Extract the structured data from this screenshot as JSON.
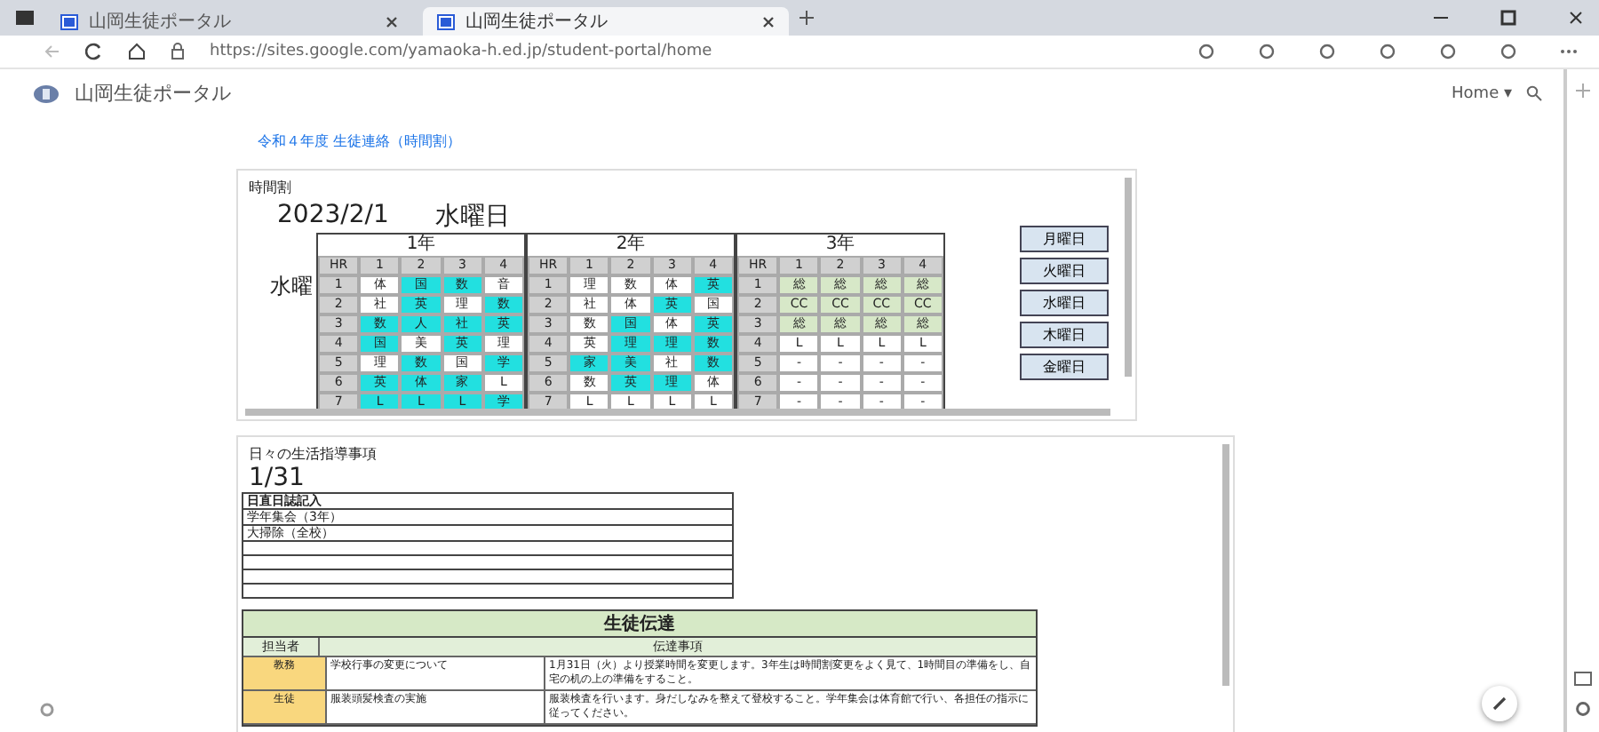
{
  "browser": {
    "tabs": [
      {
        "title": "山岡生徒ポータル",
        "selected": false
      },
      {
        "title": "山岡生徒ポータル",
        "selected": true
      }
    ],
    "url": "https://sites.google.com/yamaoka-h.ed.jp/student-portal/home"
  },
  "site": {
    "title": "山岡生徒ポータル",
    "nav": "Home ▾"
  },
  "link": "令和４年度 生徒連絡（時間割）",
  "timetable": {
    "label": "時間割",
    "date": "2023/2/1",
    "weekday": "水曜日",
    "day_label": "水曜",
    "years": [
      {
        "title": "1年",
        "header": [
          "HR",
          "1",
          "2",
          "3",
          "4"
        ],
        "rows": [
          [
            {
              "text": "1"
            },
            {
              "text": "体"
            },
            {
              "text": "国",
              "color": "#22e0e0"
            },
            {
              "text": "数",
              "color": "#22e0e0"
            },
            {
              "text": "音"
            }
          ],
          [
            {
              "text": "2"
            },
            {
              "text": "社"
            },
            {
              "text": "英",
              "color": "#22e0e0"
            },
            {
              "text": "理"
            },
            {
              "text": "数",
              "color": "#22e0e0"
            }
          ],
          [
            {
              "text": "3"
            },
            {
              "text": "数",
              "color": "#22e0e0"
            },
            {
              "text": "人",
              "color": "#22e0e0"
            },
            {
              "text": "社",
              "color": "#22e0e0"
            },
            {
              "text": "英",
              "color": "#22e0e0"
            }
          ],
          [
            {
              "text": "4"
            },
            {
              "text": "国",
              "color": "#22e0e0"
            },
            {
              "text": "美"
            },
            {
              "text": "英",
              "color": "#22e0e0"
            },
            {
              "text": "理"
            }
          ],
          [
            {
              "text": "5"
            },
            {
              "text": "理"
            },
            {
              "text": "数",
              "color": "#22e0e0"
            },
            {
              "text": "国"
            },
            {
              "text": "学",
              "color": "#22e0e0"
            }
          ],
          [
            {
              "text": "6"
            },
            {
              "text": "英",
              "color": "#22e0e0"
            },
            {
              "text": "体",
              "color": "#22e0e0"
            },
            {
              "text": "家",
              "color": "#22e0e0"
            },
            {
              "text": "L"
            }
          ],
          [
            {
              "text": "7"
            },
            {
              "text": "L",
              "color": "#22e0e0"
            },
            {
              "text": "L",
              "color": "#22e0e0"
            },
            {
              "text": "L",
              "color": "#22e0e0"
            },
            {
              "text": "学",
              "color": "#22e0e0"
            }
          ]
        ]
      },
      {
        "title": "2年",
        "header": [
          "HR",
          "1",
          "2",
          "3",
          "4"
        ],
        "rows": [
          [
            {
              "text": "1"
            },
            {
              "text": "理"
            },
            {
              "text": "数"
            },
            {
              "text": "体"
            },
            {
              "text": "英",
              "color": "#22e0e0"
            }
          ],
          [
            {
              "text": "2"
            },
            {
              "text": "社"
            },
            {
              "text": "体"
            },
            {
              "text": "英",
              "color": "#22e0e0"
            },
            {
              "text": "国"
            }
          ],
          [
            {
              "text": "3"
            },
            {
              "text": "数"
            },
            {
              "text": "国",
              "color": "#22e0e0"
            },
            {
              "text": "体"
            },
            {
              "text": "英",
              "color": "#22e0e0"
            }
          ],
          [
            {
              "text": "4"
            },
            {
              "text": "英"
            },
            {
              "text": "理",
              "color": "#22e0e0"
            },
            {
              "text": "理",
              "color": "#22e0e0"
            },
            {
              "text": "数",
              "color": "#22e0e0"
            }
          ],
          [
            {
              "text": "5"
            },
            {
              "text": "家",
              "color": "#22e0e0"
            },
            {
              "text": "美",
              "color": "#22e0e0"
            },
            {
              "text": "社"
            },
            {
              "text": "数",
              "color": "#22e0e0"
            }
          ],
          [
            {
              "text": "6"
            },
            {
              "text": "数"
            },
            {
              "text": "英",
              "color": "#22e0e0"
            },
            {
              "text": "理",
              "color": "#22e0e0"
            },
            {
              "text": "体"
            }
          ],
          [
            {
              "text": "7"
            },
            {
              "text": "L"
            },
            {
              "text": "L"
            },
            {
              "text": "L"
            },
            {
              "text": "L"
            }
          ]
        ]
      },
      {
        "title": "3年",
        "header": [
          "HR",
          "1",
          "2",
          "3",
          "4"
        ],
        "rows": [
          [
            {
              "text": "1"
            },
            {
              "text": "総",
              "color": "#d7e8c8"
            },
            {
              "text": "総",
              "color": "#d7e8c8"
            },
            {
              "text": "総",
              "color": "#d7e8c8"
            },
            {
              "text": "総",
              "color": "#d7e8c8"
            }
          ],
          [
            {
              "text": "2"
            },
            {
              "text": "CC",
              "color": "#d7e8c8"
            },
            {
              "text": "CC",
              "color": "#d7e8c8"
            },
            {
              "text": "CC",
              "color": "#d7e8c8"
            },
            {
              "text": "CC",
              "color": "#d7e8c8"
            }
          ],
          [
            {
              "text": "3"
            },
            {
              "text": "総",
              "color": "#d7e8c8"
            },
            {
              "text": "総",
              "color": "#d7e8c8"
            },
            {
              "text": "総",
              "color": "#d7e8c8"
            },
            {
              "text": "総",
              "color": "#d7e8c8"
            }
          ],
          [
            {
              "text": "4"
            },
            {
              "text": "L"
            },
            {
              "text": "L"
            },
            {
              "text": "L"
            },
            {
              "text": "L"
            }
          ],
          [
            {
              "text": "5"
            },
            {
              "text": "-"
            },
            {
              "text": "-"
            },
            {
              "text": "-"
            },
            {
              "text": "-"
            }
          ],
          [
            {
              "text": "6"
            },
            {
              "text": "-"
            },
            {
              "text": "-"
            },
            {
              "text": "-"
            },
            {
              "text": "-"
            }
          ],
          [
            {
              "text": "7"
            },
            {
              "text": "-"
            },
            {
              "text": "-"
            },
            {
              "text": "-"
            },
            {
              "text": "-"
            }
          ]
        ]
      }
    ],
    "day_buttons": [
      "月曜日",
      "火曜日",
      "水曜日",
      "木曜日",
      "金曜日"
    ]
  },
  "notices": {
    "label": "日々の生活指導事項",
    "date": "1/31",
    "heading": "日直日誌記入",
    "lines": [
      "学年集会（3年）",
      "大掃除（全校）"
    ],
    "table": {
      "title": "生徒伝達",
      "columns": [
        "担当者",
        "伝達事項"
      ],
      "rows": [
        {
          "dept": "教務",
          "subject": "学校行事の変更について",
          "detail": "1月31日（火）より授業時間を変更します。3年生は時間割変更をよく見て、1時間目の準備をし、自宅の机の上の準備をすること。"
        },
        {
          "dept": "生徒",
          "subject": "服装頭髪検査の実施",
          "detail": "服装検査を行います。身だしなみを整えて登校すること。学年集会は体育館で行い、各担任の指示に従ってください。"
        }
      ]
    }
  }
}
